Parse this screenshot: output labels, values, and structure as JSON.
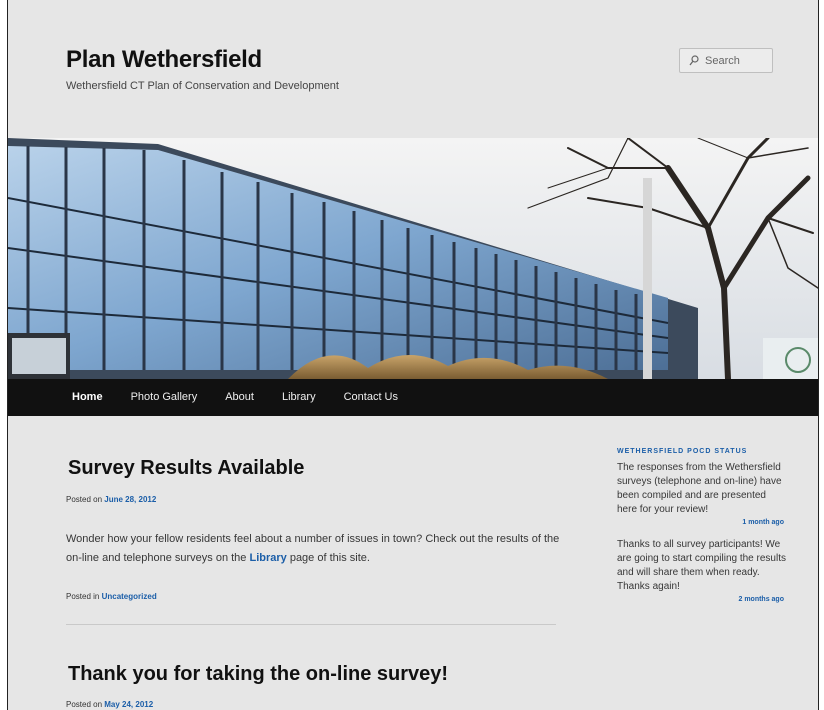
{
  "site": {
    "title": "Plan Wethersfield",
    "description": "Wethersfield CT Plan of Conservation and Development"
  },
  "search": {
    "placeholder": "Search"
  },
  "nav": {
    "items": [
      {
        "label": "Home"
      },
      {
        "label": "Photo Gallery"
      },
      {
        "label": "About"
      },
      {
        "label": "Library"
      },
      {
        "label": "Contact Us"
      }
    ]
  },
  "posts": [
    {
      "title": "Survey Results Available",
      "posted_prefix": "Posted on ",
      "date": "June 28, 2012",
      "excerpt_before": "Wonder how your fellow residents feel about a number of issues in town?  Check out the results of the on-line and telephone surveys on the ",
      "excerpt_link": "Library",
      "excerpt_after": " page of this site.",
      "category_prefix": "Posted in ",
      "category": "Uncategorized"
    },
    {
      "title": "Thank you for taking the on-line survey!",
      "posted_prefix": "Posted on ",
      "date": "May 24, 2012"
    }
  ],
  "sidebar": {
    "widget_title": "WETHERSFIELD POCD STATUS",
    "tweets": [
      {
        "text": "The responses from the Wethersfield surveys (telephone and on-line) have been compiled and are presented here for your review!",
        "time": "1 month ago"
      },
      {
        "text": "Thanks to all survey participants! We are going to start compiling the results and will share them when ready. Thanks again!",
        "time": "2 months ago"
      }
    ]
  },
  "colors": {
    "background": "#e6e6e6",
    "nav_bg": "#111111",
    "link": "#1b5ea8",
    "text": "#373737"
  }
}
